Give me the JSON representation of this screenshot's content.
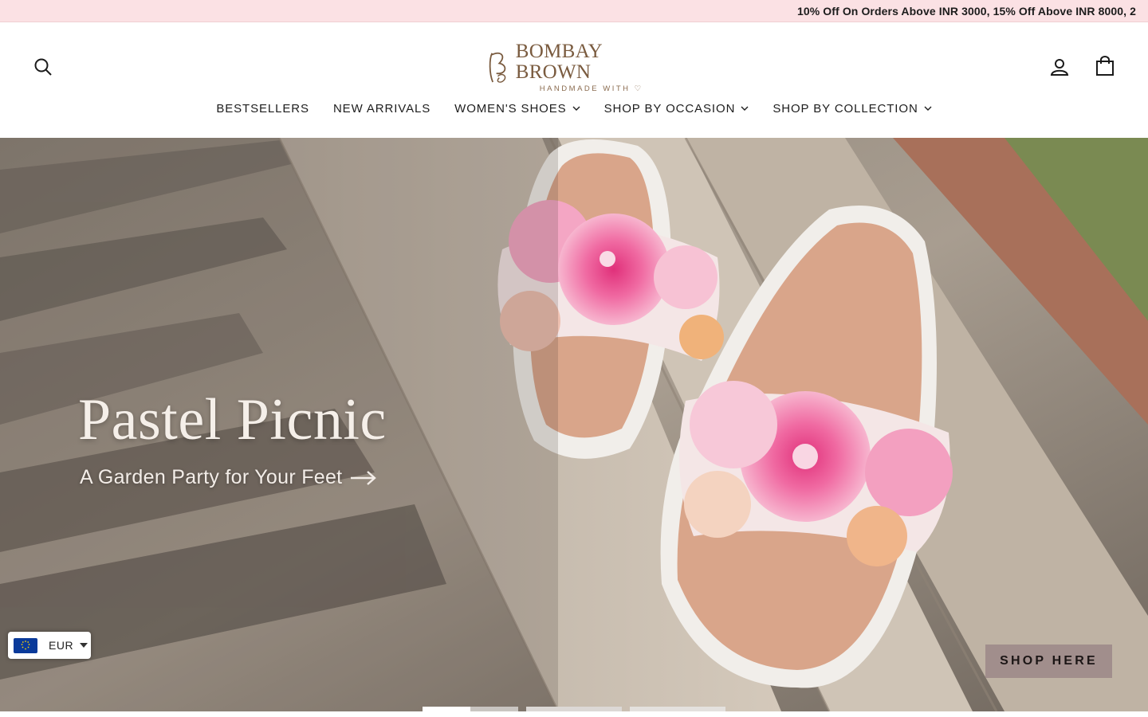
{
  "announcement": "10% Off On Orders Above INR 3000, 15% Off Above INR 8000, 2",
  "brand": {
    "name": "BOMBAY BROWN",
    "tagline": "HANDMADE WITH ♡"
  },
  "icons": {
    "search": "search-icon",
    "account": "user-icon",
    "cart": "shopping-bag-icon"
  },
  "nav": [
    {
      "label": "BESTSELLERS",
      "dropdown": false
    },
    {
      "label": "NEW ARRIVALS",
      "dropdown": false
    },
    {
      "label": "WOMEN'S SHOES",
      "dropdown": true
    },
    {
      "label": "SHOP BY OCCASION",
      "dropdown": true
    },
    {
      "label": "SHOP BY COLLECTION",
      "dropdown": true
    }
  ],
  "hero": {
    "title": "Pastel Picnic",
    "subtitle": "A Garden Party for Your Feet",
    "cta": "SHOP HERE"
  },
  "currency": {
    "code": "EUR",
    "flag": "eu-flag"
  },
  "slider": {
    "total": 3,
    "active": 1
  },
  "colors": {
    "announcement_bg": "#fbe1e4",
    "brand": "#7a5b3f"
  }
}
